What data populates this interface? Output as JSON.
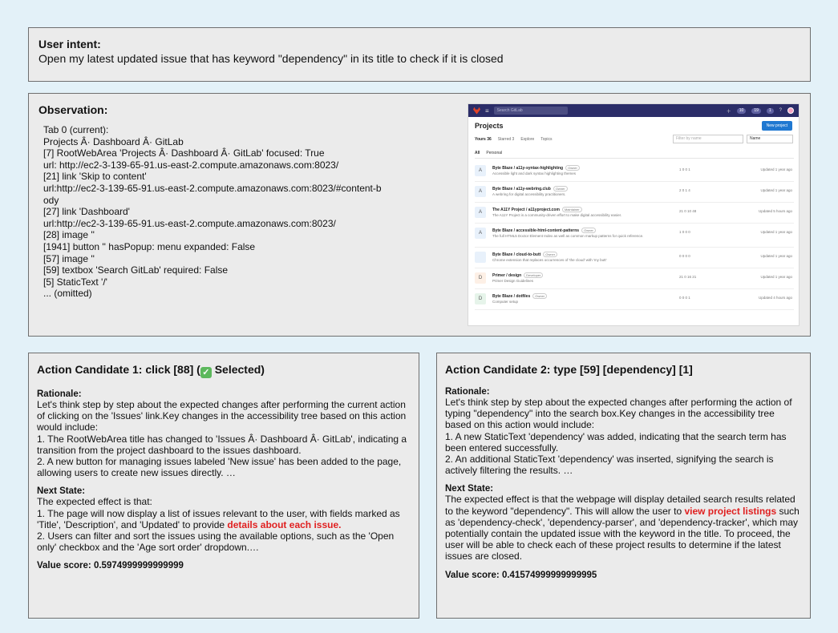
{
  "intent": {
    "heading": "User intent:",
    "text": "Open my latest updated issue that has keyword \"dependency\" in its title to check if it is closed"
  },
  "observation": {
    "heading": "Observation:",
    "lines": [
      "Tab 0 (current):",
      "Projects Â· Dashboard Â· GitLab",
      "[7] RootWebArea 'Projects Â· Dashboard Â· GitLab' focused: True",
      "url: http://ec2-3-139-65-91.us-east-2.compute.amazonaws.com:8023/",
      "[21] link 'Skip to content'",
      "url:http://ec2-3-139-65-91.us-east-2.compute.amazonaws.com:8023/#content-b",
      "ody",
      "[27] link 'Dashboard'",
      "url:http://ec2-3-139-65-91.us-east-2.compute.amazonaws.com:8023/",
      "[28] image ''",
      "[1941] button '' hasPopup: menu expanded: False",
      "[57] image ''",
      "[59] textbox 'Search GitLab' required: False",
      "[5] StaticText '/'",
      "... (omitted)"
    ],
    "screenshot": {
      "search_placeholder": "Search GitLab",
      "search_key": "/",
      "title": "Projects",
      "new_button": "New project",
      "tabs": [
        "Yours 36",
        "Starred 3",
        "Explore",
        "Topics"
      ],
      "filter_placeholder": "Filter by name",
      "sort_label": "Name",
      "subtabs": [
        "All",
        "Personal"
      ],
      "badges": [
        "10",
        "19",
        "1"
      ],
      "projects": [
        {
          "avatar": "A",
          "name": "Byte Blaze / a11y-syntax-highlighting",
          "role": "Owner",
          "desc": "Accessible light and dark syntax highlighting themes",
          "stats": "1  0  0  1",
          "updated": "Updated 1 year ago"
        },
        {
          "avatar": "A",
          "name": "Byte Blaze / a11y-webring.club",
          "role": "Owner",
          "desc": "A webring for digital accessibility practitioners.",
          "stats": "2  0  1  4",
          "updated": "Updated 1 year ago"
        },
        {
          "avatar": "A",
          "name": "The A11Y Project / a11yproject.com",
          "role": "Maintainer",
          "desc": "The A11Y Project is a community-driven effort to make digital accessibility easier.",
          "stats": "21  0  10  48",
          "updated": "Updated 5 hours ago"
        },
        {
          "avatar": "A",
          "name": "Byte Blaze / accessible-html-content-patterns",
          "role": "Owner",
          "desc": "The full HTML5 Doctor Element Index as well as common markup patterns for quick reference.",
          "stats": "1  0  0  0",
          "updated": "Updated 1 year ago"
        },
        {
          "avatar": "",
          "name": "Byte Blaze / cloud-to-butt",
          "role": "Owner",
          "desc": "Chrome extension that replaces occurrences of 'the cloud' with 'my butt'",
          "stats": "0  0  0  0",
          "updated": "Updated 1 year ago"
        },
        {
          "avatar": "D",
          "name": "Primer / design",
          "role": "Developer",
          "desc": "Primer Design Guidelines",
          "stats": "21  0  16  21",
          "updated": "Updated 1 year ago"
        },
        {
          "avatar": "D",
          "name": "Byte Blaze / dotfiles",
          "role": "Owner",
          "desc": "Computer setup",
          "stats": "0  0  0  1",
          "updated": "Updated 4 hours ago"
        }
      ]
    }
  },
  "candidates": [
    {
      "title": "Action Candidate 1: click [88] (",
      "title_suffix": " Selected)",
      "selected_mark": "✓",
      "rationale_label": "Rationale:",
      "rationale": [
        "Let's think step by step about the expected changes after performing the current action of clicking on the 'Issues' link.Key changes in the accessibility tree based on this action would include:",
        "1. The RootWebArea title has changed to 'Issues Â· Dashboard Â· GitLab', indicating a transition from the project dashboard to the issues dashboard.",
        "2. A new button for managing issues labeled 'New issue' has been added to the page, allowing users to create new issues directly. …"
      ],
      "next_label": "Next State:",
      "next_intro": "The expected effect is that:",
      "next_1_pre": "1. The page will now display a list of issues relevant to the user, with fields marked as 'Title', 'Description', and 'Updated' to provide ",
      "next_1_hl": "details about each issue.",
      "next_2": "2. Users can filter and sort the issues using the available options, such as the 'Open only' checkbox and the 'Age sort order' dropdown.…",
      "score": "Value score: 0.5974999999999999"
    },
    {
      "title": "Action Candidate 2: type [59] [dependency] [1]",
      "rationale_label": "Rationale:",
      "rationale": [
        "Let's think step by step about the expected changes after performing the action of typing \"dependency\" into the search box.Key changes in the accessibility tree based on this action would include:",
        "1. A new StaticText 'dependency' was added, indicating that the search term has been entered successfully.",
        "2. An additional StaticText 'dependency' was inserted, signifying the search is actively filtering the results. …"
      ],
      "next_label": "Next State:",
      "next_pre": "The expected effect is that the webpage will display detailed search results related to the keyword \"dependency\". This will allow the user to ",
      "next_hl": "view project listings",
      "next_post": " such as 'dependency-check', 'dependency-parser', and 'dependency-tracker', which may potentially contain the updated issue with the keyword in the title. To proceed, the user will be able to check each of these project results to determine if the latest issues are closed.",
      "score": "Value score: 0.41574999999999995"
    }
  ]
}
